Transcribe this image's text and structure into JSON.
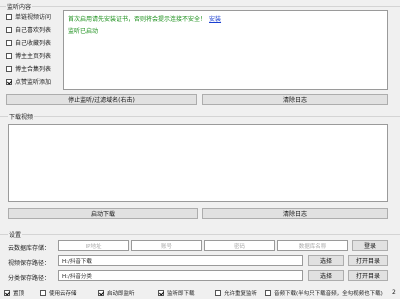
{
  "monitor": {
    "title": "监听内容",
    "options": [
      {
        "label": "单链视频访问",
        "checked": false
      },
      {
        "label": "自己喜欢列表",
        "checked": false
      },
      {
        "label": "自己收藏列表",
        "checked": false
      },
      {
        "label": "博主主页列表",
        "checked": false
      },
      {
        "label": "博主合集列表",
        "checked": false
      },
      {
        "label": "点赞监听添加",
        "checked": true
      }
    ],
    "log_line1": "首次启用请先安装证书，否则将会提示连接不安全！",
    "log_link": "安装",
    "log_line2": "监听已启动",
    "stop_button": "停止监听/过滤域名(右击)",
    "clear_button": "清除日志"
  },
  "download": {
    "title": "下载视频",
    "start_button": "启动下载",
    "clear_button": "清除日志"
  },
  "settings": {
    "title": "设置",
    "cloud_label": "云数据库存储：",
    "cloud_ip_placeholder": "IP地址",
    "cloud_account_placeholder": "账号",
    "cloud_password_placeholder": "密码",
    "cloud_dbname_placeholder": "数据库名称",
    "login_button": "登录",
    "video_path_label": "视频保存路径：",
    "video_path_value": "H:/抖音下载",
    "video_select_button": "选择",
    "video_open_button": "打开目录",
    "split_path_label": "分类保存路径：",
    "split_path_value": "H:/抖音分类",
    "split_select_button": "选择",
    "split_open_button": "打开目录",
    "bottom_options": [
      {
        "label": "置顶",
        "checked": true
      },
      {
        "label": "使用云存储",
        "checked": false
      },
      {
        "label": "启动即监听",
        "checked": true
      },
      {
        "label": "监听即下载",
        "checked": true
      },
      {
        "label": "允许重复监听",
        "checked": false
      },
      {
        "label": "音频下载(半勾只下载音频，全勾视频也下载)",
        "checked": false
      }
    ],
    "bottom_corner": "2"
  }
}
